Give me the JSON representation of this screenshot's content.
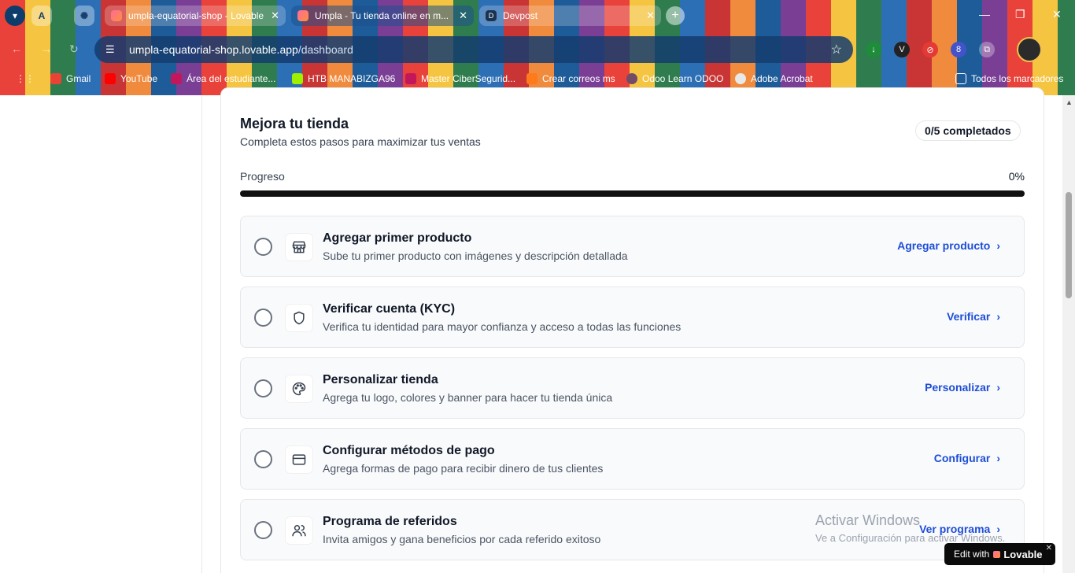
{
  "browser": {
    "tabs": [
      {
        "title": "umpla-equatorial-shop - Lovable",
        "active": false
      },
      {
        "title": "Umpla - Tu tienda online en m...",
        "active": true
      },
      {
        "title": "Devpost",
        "active": false
      }
    ],
    "url_host": "umpla-equatorial-shop.lovable.app",
    "url_path": "/dashboard",
    "extension_badge": "8",
    "bookmarks": [
      {
        "label": "Gmail"
      },
      {
        "label": "YouTube"
      },
      {
        "label": "Área del estudiante..."
      },
      {
        "label": "HTB MANABIZGA96"
      },
      {
        "label": "Master CiberSegurid..."
      },
      {
        "label": "Crear correos ms"
      },
      {
        "label": "Odoo Learn ODOO"
      },
      {
        "label": "Adobe Acrobat"
      },
      {
        "label": "Todos los marcadores"
      }
    ]
  },
  "checklist": {
    "title": "Mejora tu tienda",
    "subtitle": "Completa estos pasos para maximizar tus ventas",
    "badge": "0/5 completados",
    "progress_label": "Progreso",
    "progress_text": "0%",
    "progress_fraction": 0,
    "steps": [
      {
        "title": "Agregar primer producto",
        "desc": "Sube tu primer producto con imágenes y descripción detallada",
        "action": "Agregar producto",
        "icon": "store-icon"
      },
      {
        "title": "Verificar cuenta (KYC)",
        "desc": "Verifica tu identidad para mayor confianza y acceso a todas las funciones",
        "action": "Verificar",
        "icon": "shield-icon"
      },
      {
        "title": "Personalizar tienda",
        "desc": "Agrega tu logo, colores y banner para hacer tu tienda única",
        "action": "Personalizar",
        "icon": "palette-icon"
      },
      {
        "title": "Configurar métodos de pago",
        "desc": "Agrega formas de pago para recibir dinero de tus clientes",
        "action": "Configurar",
        "icon": "credit-card-icon"
      },
      {
        "title": "Programa de referidos",
        "desc": "Invita amigos y gana beneficios por cada referido exitoso",
        "action": "Ver programa",
        "icon": "users-icon"
      }
    ]
  },
  "overlay": {
    "windows_activate_title": "Activar Windows",
    "windows_activate_sub": "Ve a Configuración para activar Windows.",
    "lovable_badge_prefix": "Edit with",
    "lovable_badge_brand": "Lovable"
  },
  "colors": {
    "accent": "#1d4ed8",
    "progress_track": "#111111"
  }
}
